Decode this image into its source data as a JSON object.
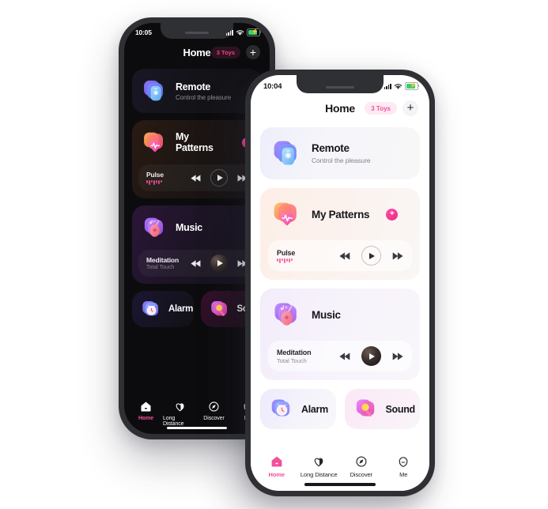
{
  "app": {
    "accent_pink": "#f2509a",
    "accent_purple": "#7b5cf0"
  },
  "phones": [
    {
      "id": "back-phone",
      "theme": "dark",
      "status": {
        "time": "10:05",
        "signal_icon": "cellular-bars-icon",
        "wifi_icon": "wifi-icon",
        "battery_icon": "battery-charging-icon"
      },
      "header": {
        "title": "Home",
        "toys_badge": "3 Toys",
        "add_label": "+"
      },
      "cards": {
        "remote": {
          "title": "Remote",
          "subtitle": "Control the pleasure",
          "icon": "remote-device-icon"
        },
        "patterns": {
          "title": "My Patterns",
          "icon": "heart-pulse-icon",
          "add_label": "+",
          "track": "Pulse"
        },
        "music": {
          "title": "Music",
          "icon": "guitar-music-icon",
          "track": "Meditation",
          "track_sub": "Total Touch"
        },
        "alarm": {
          "title": "Alarm",
          "icon": "alarm-clock-icon"
        },
        "sound": {
          "title": "Sound",
          "icon": "microphone-icon"
        }
      },
      "tabs": [
        {
          "label": "Home",
          "icon": "home-icon",
          "active": true
        },
        {
          "label": "Long Distance",
          "icon": "long-distance-heart-icon",
          "active": false
        },
        {
          "label": "Discover",
          "icon": "discover-icon",
          "active": false
        },
        {
          "label": "Me",
          "icon": "me-profile-icon",
          "active": false
        }
      ]
    },
    {
      "id": "front-phone",
      "theme": "light",
      "status": {
        "time": "10:04",
        "signal_icon": "cellular-bars-icon",
        "wifi_icon": "wifi-icon",
        "battery_icon": "battery-charging-icon"
      },
      "header": {
        "title": "Home",
        "toys_badge": "3 Toys",
        "add_label": "+"
      },
      "cards": {
        "remote": {
          "title": "Remote",
          "subtitle": "Control the pleasure",
          "icon": "remote-device-icon"
        },
        "patterns": {
          "title": "My Patterns",
          "icon": "heart-pulse-icon",
          "add_label": "+",
          "track": "Pulse"
        },
        "music": {
          "title": "Music",
          "icon": "guitar-music-icon",
          "track": "Meditation",
          "track_sub": "Total Touch"
        },
        "alarm": {
          "title": "Alarm",
          "icon": "alarm-clock-icon"
        },
        "sound": {
          "title": "Sound",
          "icon": "microphone-icon"
        }
      },
      "tabs": [
        {
          "label": "Home",
          "icon": "home-icon",
          "active": true
        },
        {
          "label": "Long Distance",
          "icon": "long-distance-heart-icon",
          "active": false
        },
        {
          "label": "Discover",
          "icon": "discover-icon",
          "active": false
        },
        {
          "label": "Me",
          "icon": "me-profile-icon",
          "active": false
        }
      ]
    }
  ]
}
